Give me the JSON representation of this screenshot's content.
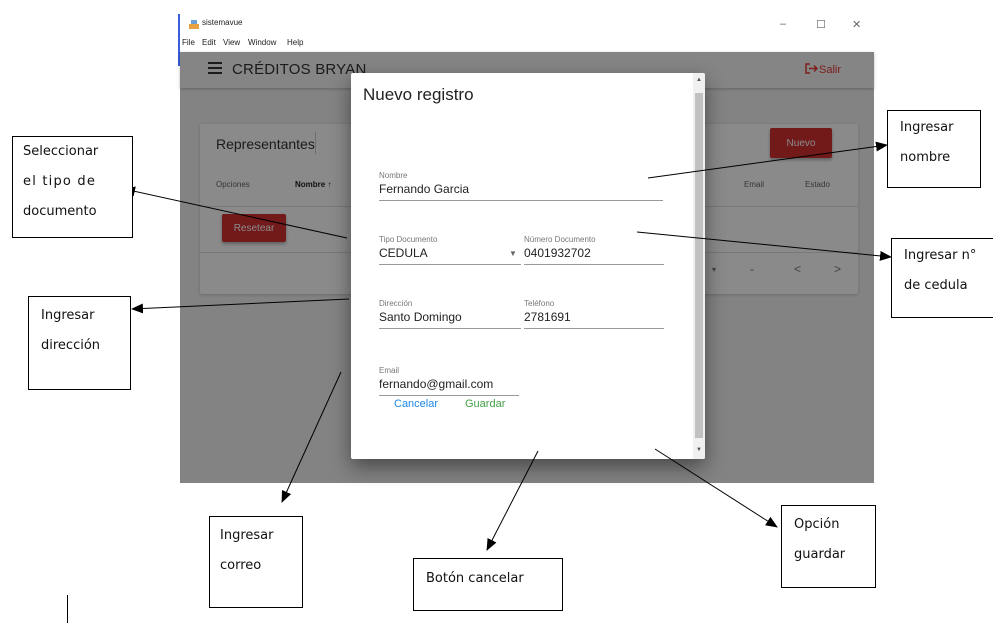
{
  "window": {
    "title": "sistemavue",
    "menu": [
      "File",
      "Edit",
      "View",
      "Window",
      "Help"
    ],
    "controls": {
      "minimize": "–",
      "maximize": "☐",
      "close": "✕"
    }
  },
  "toolbar": {
    "app_name": "CRÉDITOS BRYAN",
    "logout_label": "Salir",
    "logout_icon": "logout-icon"
  },
  "card": {
    "title": "Representantes",
    "new_button": "Nuevo",
    "columns": [
      "Opciones",
      "Nombre ↑",
      "Email",
      "Estado"
    ],
    "reset_button": "Resetear",
    "pager": {
      "rows_caret": "▾",
      "range": "-",
      "prev": "<",
      "next": ">"
    }
  },
  "dialog": {
    "title": "Nuevo registro",
    "fields": {
      "nombre": {
        "label": "Nombre",
        "value": "Fernando Garcia"
      },
      "tipo_documento": {
        "label": "Tipo Documento",
        "value": "CEDULA"
      },
      "numero_documento": {
        "label": "Número Documento",
        "value": "0401932702"
      },
      "direccion": {
        "label": "Dirección",
        "value": "Santo Domingo"
      },
      "telefono": {
        "label": "Teléfono",
        "value": "2781691"
      },
      "email": {
        "label": "Email",
        "value": "fernando@gmail.com"
      }
    },
    "cancel_label": "Cancelar",
    "save_label": "Guardar"
  },
  "callouts": {
    "tipo_documento": [
      "Seleccionar",
      "el tipo de",
      "documento"
    ],
    "direccion": [
      "Ingresar",
      "dirección"
    ],
    "correo": [
      "Ingresar",
      "correo"
    ],
    "cancelar": [
      "Botón cancelar"
    ],
    "guardar": [
      "Opción",
      "guardar"
    ],
    "nombre": [
      "Ingresar",
      "nombre"
    ],
    "cedula": [
      "Ingresar n°",
      "de cedula"
    ]
  },
  "colors": {
    "primary_red": "#d32f2f",
    "cancel_blue": "#1e88e5",
    "save_green": "#43a047"
  }
}
